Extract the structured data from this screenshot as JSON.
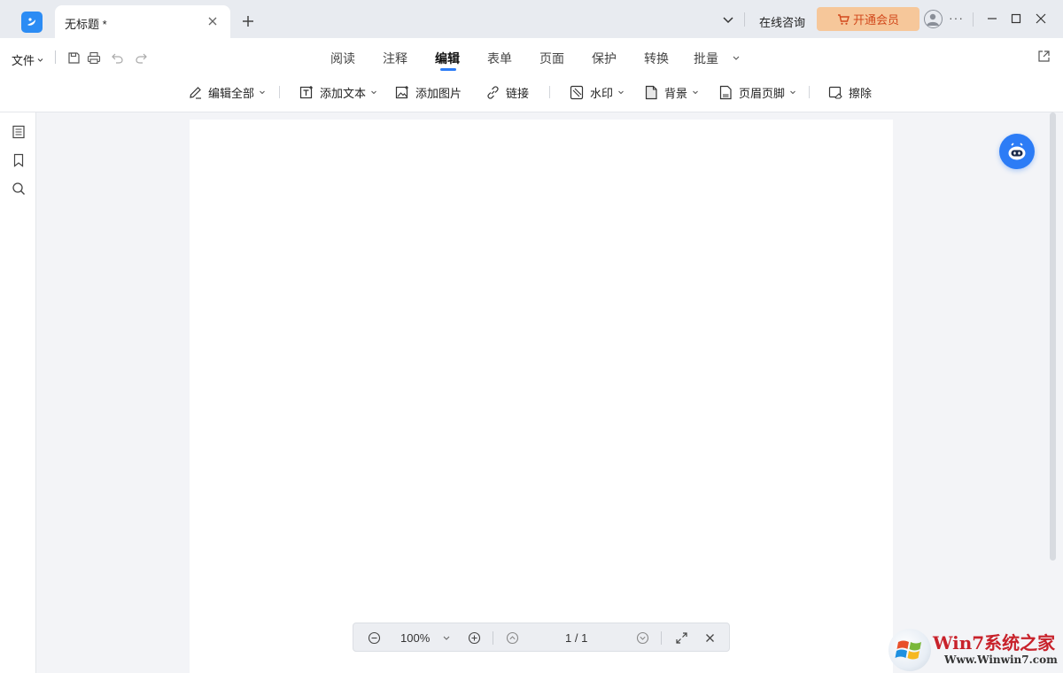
{
  "titlebar": {
    "tab_title": "无标题 *",
    "consult_label": "在线咨询",
    "vip_label": "开通会员",
    "more_label": "···"
  },
  "toolbar": {
    "file_label": "文件",
    "tabs": [
      {
        "label": "阅读"
      },
      {
        "label": "注释"
      },
      {
        "label": "编辑"
      },
      {
        "label": "表单"
      },
      {
        "label": "页面"
      },
      {
        "label": "保护"
      },
      {
        "label": "转换"
      },
      {
        "label": "批量"
      }
    ],
    "active_tab": "编辑",
    "tools": [
      {
        "label": "编辑全部",
        "icon": "pen-icon"
      },
      {
        "label": "添加文本",
        "icon": "add-text-icon"
      },
      {
        "label": "添加图片",
        "icon": "add-image-icon"
      },
      {
        "label": "链接",
        "icon": "link-icon"
      },
      {
        "label": "水印",
        "icon": "watermark-icon"
      },
      {
        "label": "背景",
        "icon": "background-icon"
      },
      {
        "label": "页眉页脚",
        "icon": "header-footer-icon"
      },
      {
        "label": "擦除",
        "icon": "eraser-icon"
      }
    ]
  },
  "bottom_bar": {
    "zoom": "100%",
    "page_indicator": "1 / 1"
  },
  "watermark": {
    "title": "Win7系统之家",
    "url": "Www.Winwin7.com"
  },
  "colors": {
    "accent": "#2c7cf6",
    "vip_bg": "#f6c79a",
    "vip_text": "#d2491c"
  }
}
